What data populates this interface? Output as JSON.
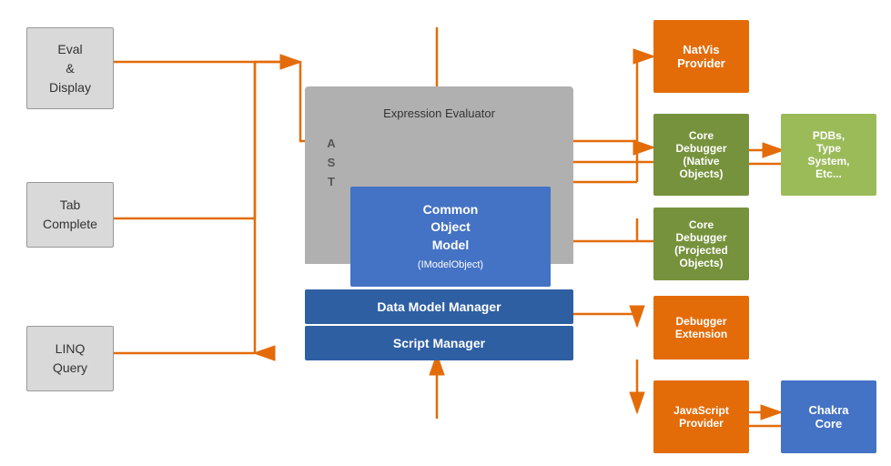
{
  "boxes": {
    "eval_display": {
      "label": "Eval\n&\nDisplay"
    },
    "tab_complete": {
      "label": "Tab\nComplete"
    },
    "linq_query": {
      "label": "LINQ\nQuery"
    },
    "expression_evaluator": {
      "label": "Expression Evaluator"
    },
    "ast_label": {
      "label": "A\nS\nT"
    },
    "common_object_model": {
      "label": "Common\nObject\nModel\n(IModelObject)"
    },
    "data_model_manager": {
      "label": "Data Model Manager"
    },
    "script_manager": {
      "label": "Script Manager"
    },
    "natvis_provider": {
      "label": "NatVis\nProvider"
    },
    "core_debugger_native": {
      "label": "Core\nDebugger\n(Native\nObjects)"
    },
    "pdbs": {
      "label": "PDBs,\nType\nSystem,\nEtc..."
    },
    "core_debugger_projected": {
      "label": "Core\nDebugger\n(Projected\nObjects)"
    },
    "debugger_extension": {
      "label": "Debugger\nExtension"
    },
    "javascript_provider": {
      "label": "JavaScript\nProvider"
    },
    "chakra_core": {
      "label": "Chakra\nCore"
    }
  }
}
